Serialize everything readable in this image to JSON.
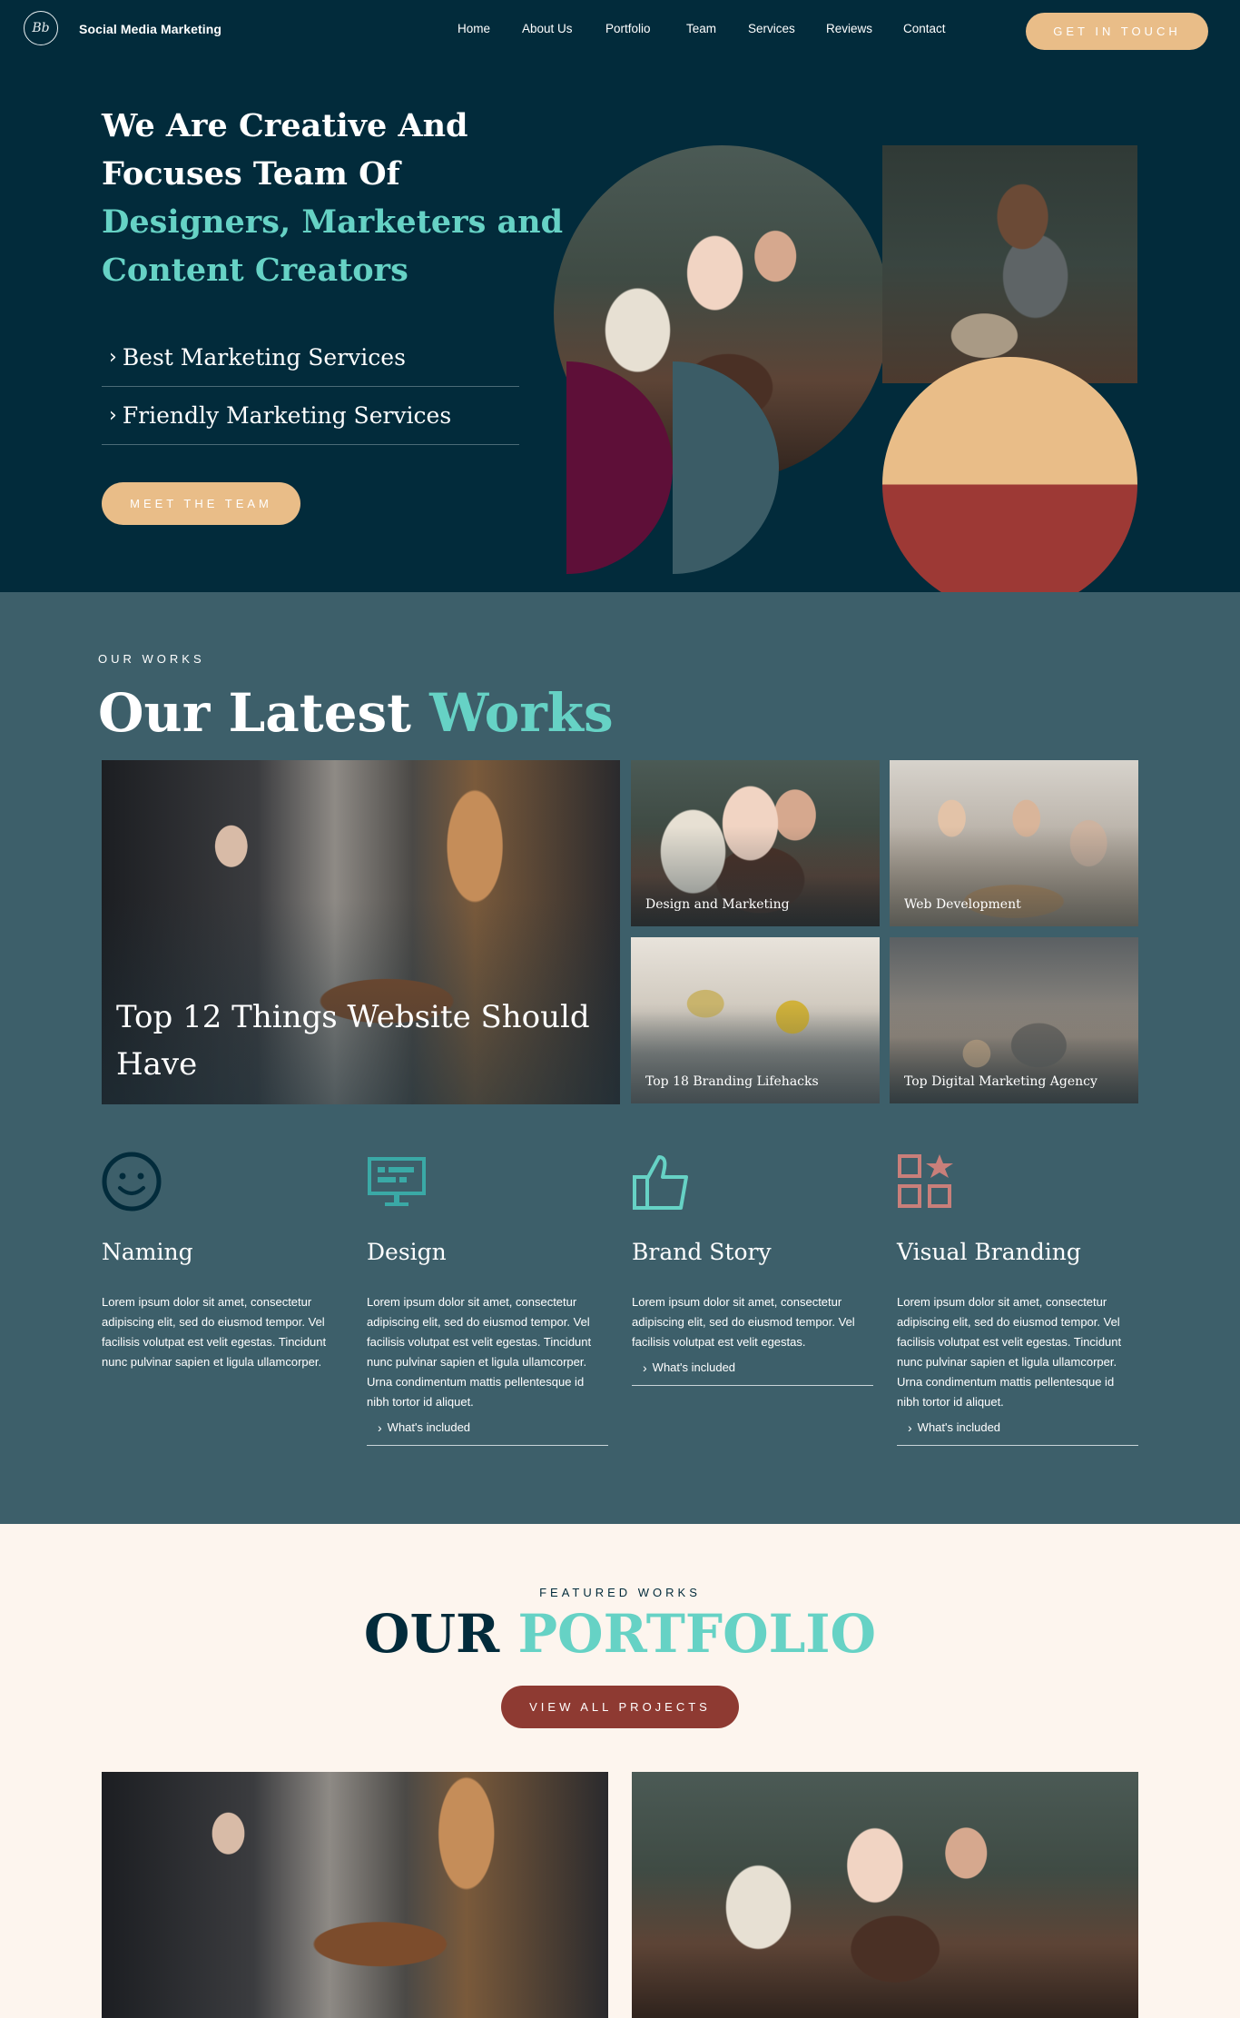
{
  "nav": {
    "logo_glyph": "Bb",
    "brand": "Social Media Marketing",
    "links": [
      "Home",
      "About Us",
      "Portfolio",
      "Team",
      "Services",
      "Reviews",
      "Contact"
    ],
    "cta": "GET IN TOUCH"
  },
  "hero": {
    "title_lines": [
      "We Are Creative And",
      "Focuses Team Of"
    ],
    "title_accent_lines": [
      "Designers, Marketers and",
      "Content Creators"
    ],
    "items": [
      "Best Marketing Services",
      "Friendly Marketing Services"
    ],
    "cta": "MEET THE TEAM"
  },
  "colors": {
    "navy": "#022b3b",
    "teal_bg": "#3d5f6a",
    "accent_teal": "#66d2c5",
    "sand": "#e9bd88",
    "plum": "#5e0f38",
    "slate": "#3b5c66",
    "brick": "#9d3935",
    "cream": "#fdf5ee",
    "coral": "#c97f7a"
  },
  "works": {
    "eyebrow": "OUR WORKS",
    "title": "Our Latest",
    "title_accent": "Works",
    "featured_caption": "Top 12 Things Website Should Have",
    "tiles": [
      "Design and Marketing",
      "Web Development",
      "Top 18 Branding Lifehacks",
      "Top Digital Marketing Agency"
    ]
  },
  "services": [
    {
      "icon": "smiley-icon",
      "title": "Naming",
      "body": "Lorem ipsum dolor sit amet, consectetur adipiscing elit, sed do eiusmod tempor. Vel facilisis volutpat est velit egestas. Tincidunt nunc pulvinar sapien et ligula ullamcorper.",
      "link": ""
    },
    {
      "icon": "monitor-icon",
      "title": "Design",
      "body": "Lorem ipsum dolor sit amet, consectetur adipiscing elit, sed do eiusmod tempor. Vel facilisis volutpat est velit egestas. Tincidunt nunc pulvinar sapien et ligula ullamcorper. Urna condimentum mattis pellentesque id nibh tortor id aliquet.",
      "link": "What's included"
    },
    {
      "icon": "thumbs-up-icon",
      "title": "Brand Story",
      "body": "Lorem ipsum dolor sit amet, consectetur adipiscing elit, sed do eiusmod tempor. Vel facilisis volutpat est velit egestas.",
      "link": "What's included"
    },
    {
      "icon": "grid-star-icon",
      "title": "Visual Branding",
      "body": "Lorem ipsum dolor sit amet, consectetur adipiscing elit, sed do eiusmod tempor. Vel facilisis volutpat est velit egestas. Tincidunt nunc pulvinar sapien et ligula ullamcorper. Urna condimentum mattis pellentesque id nibh tortor id aliquet.",
      "link": "What's included"
    }
  ],
  "portfolio": {
    "eyebrow": "FEATURED WORKS",
    "title": "OUR",
    "title_accent": "PORTFOLIO",
    "cta": "VIEW ALL PROJECTS"
  }
}
